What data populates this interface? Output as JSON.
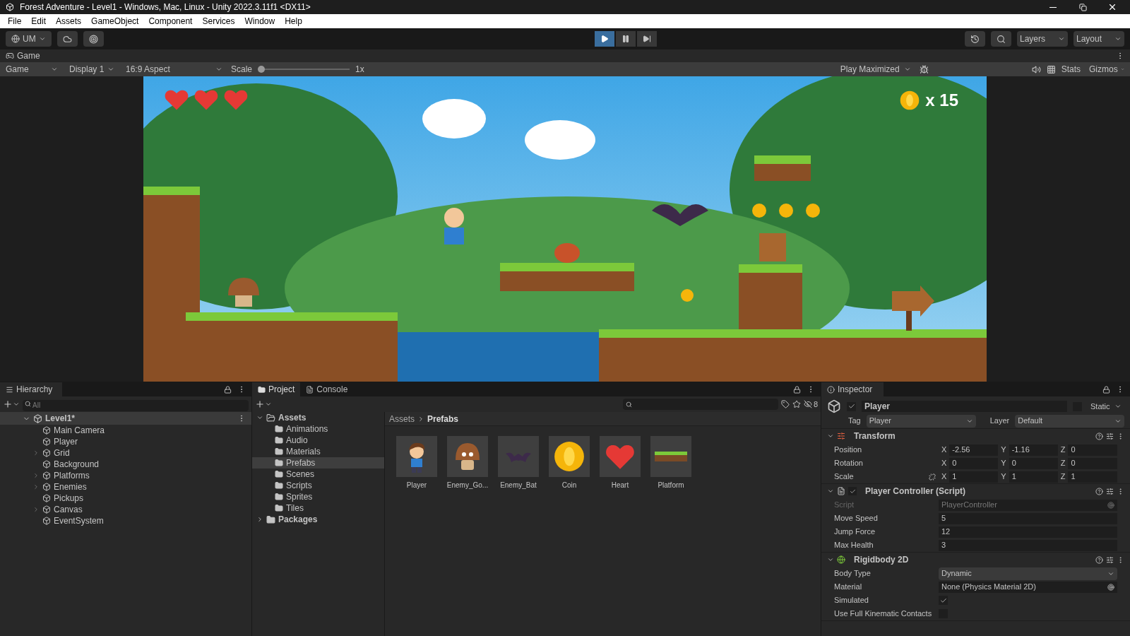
{
  "window": {
    "title": "Forest Adventure - Level1 - Windows, Mac, Linux - Unity 2022.3.11f1 <DX11>"
  },
  "menu": [
    "File",
    "Edit",
    "Assets",
    "GameObject",
    "Component",
    "Services",
    "Window",
    "Help"
  ],
  "toolbar": {
    "account": "UM",
    "play_controls": [
      {
        "kind": "play",
        "selected": true
      },
      {
        "kind": "pause",
        "selected": false
      },
      {
        "kind": "step",
        "selected": false
      }
    ],
    "layers": "Layers",
    "layout": "Layout"
  },
  "game_view": {
    "tab": "Game",
    "mode": "Game",
    "display": "Display 1",
    "aspect": "16:9 Aspect",
    "scale_label": "Scale",
    "scale": {
      "level": 0.0
    },
    "scale_value": "1x",
    "play_mode": "Play Maximized",
    "stats": "Stats",
    "gizmos": "Gizmos",
    "hud": {
      "hearts": [
        {
          "filled": true
        },
        {
          "filled": true
        },
        {
          "filled": true
        }
      ],
      "coins": "x 15"
    }
  },
  "hierarchy": {
    "tab": "Hierarchy",
    "search_placeholder": "All",
    "root": {
      "label": "Level1*",
      "expanded": true,
      "children": [
        {
          "label": "Main Camera",
          "kind": "leaf"
        },
        {
          "label": "Player",
          "kind": "leaf"
        },
        {
          "label": "Grid",
          "kind": "group"
        },
        {
          "label": "Background",
          "kind": "leaf"
        },
        {
          "label": "Platforms",
          "kind": "group"
        },
        {
          "label": "Enemies",
          "kind": "group"
        },
        {
          "label": "Pickups",
          "kind": "leaf"
        },
        {
          "label": "Canvas",
          "kind": "group"
        },
        {
          "label": "EventSystem",
          "kind": "leaf"
        }
      ]
    }
  },
  "project": {
    "tabs": [
      {
        "label": "Project",
        "selected": true
      },
      {
        "label": "Console",
        "selected": false
      }
    ],
    "hidden_count": "8",
    "tree": [
      {
        "label": "Assets",
        "expanded": true,
        "children": [
          {
            "label": "Animations",
            "selected": false
          },
          {
            "label": "Audio",
            "selected": false
          },
          {
            "label": "Materials",
            "selected": false
          },
          {
            "label": "Prefabs",
            "selected": true
          },
          {
            "label": "Scenes",
            "selected": false
          },
          {
            "label": "Scripts",
            "selected": false
          },
          {
            "label": "Sprites",
            "selected": false
          },
          {
            "label": "Tiles",
            "selected": false
          }
        ]
      },
      {
        "label": "Packages",
        "expanded": false
      }
    ],
    "breadcrumb": [
      "Assets",
      "Prefabs"
    ],
    "assets": [
      {
        "label": "Player",
        "kind": "player"
      },
      {
        "label": "Enemy_Go...",
        "kind": "mushroom"
      },
      {
        "label": "Enemy_Bat",
        "kind": "bat"
      },
      {
        "label": "Coin",
        "kind": "coin"
      },
      {
        "label": "Heart",
        "kind": "heart"
      },
      {
        "label": "Platform",
        "kind": "platform"
      }
    ]
  },
  "inspector": {
    "tab": "Inspector",
    "active": true,
    "name": "Player",
    "static_label": "Static",
    "static": false,
    "tag_label": "Tag",
    "tag": "Player",
    "layer_label": "Layer",
    "layer": "Default",
    "components": [
      {
        "kind": "transform",
        "title": "Transform",
        "rows": [
          {
            "label": "Position",
            "values": [
              {
                "axis": "X",
                "value": "-2.56"
              },
              {
                "axis": "Y",
                "value": "-1.16"
              },
              {
                "axis": "Z",
                "value": "0"
              }
            ]
          },
          {
            "label": "Rotation",
            "values": [
              {
                "axis": "X",
                "value": "0"
              },
              {
                "axis": "Y",
                "value": "0"
              },
              {
                "axis": "Z",
                "value": "0"
              }
            ]
          },
          {
            "label": "Scale",
            "values": [
              {
                "axis": "X",
                "value": "1"
              },
              {
                "axis": "Y",
                "value": "1"
              },
              {
                "axis": "Z",
                "value": "1"
              }
            ]
          }
        ]
      },
      {
        "kind": "script",
        "title": "Player Controller (Script)",
        "enabled": true,
        "fields": [
          {
            "label": "Script",
            "value": "PlayerController",
            "kind": "object",
            "disabled": true
          },
          {
            "label": "Move Speed",
            "value": "5",
            "kind": "text",
            "disabled": false
          },
          {
            "label": "Jump Force",
            "value": "12",
            "kind": "text",
            "disabled": false
          },
          {
            "label": "Max Health",
            "value": "3",
            "kind": "text",
            "disabled": false
          }
        ]
      },
      {
        "kind": "rigidbody",
        "title": "Rigidbody 2D",
        "fields": [
          {
            "label": "Body Type",
            "value": "Dynamic",
            "kind": "dropdown"
          },
          {
            "label": "Material",
            "value": "None (Physics Material 2D)",
            "kind": "object"
          },
          {
            "label": "Simulated",
            "kind": "check",
            "checked": true
          },
          {
            "label": "Use Full Kinematic Contacts",
            "kind": "check",
            "checked": false
          }
        ]
      }
    ]
  }
}
